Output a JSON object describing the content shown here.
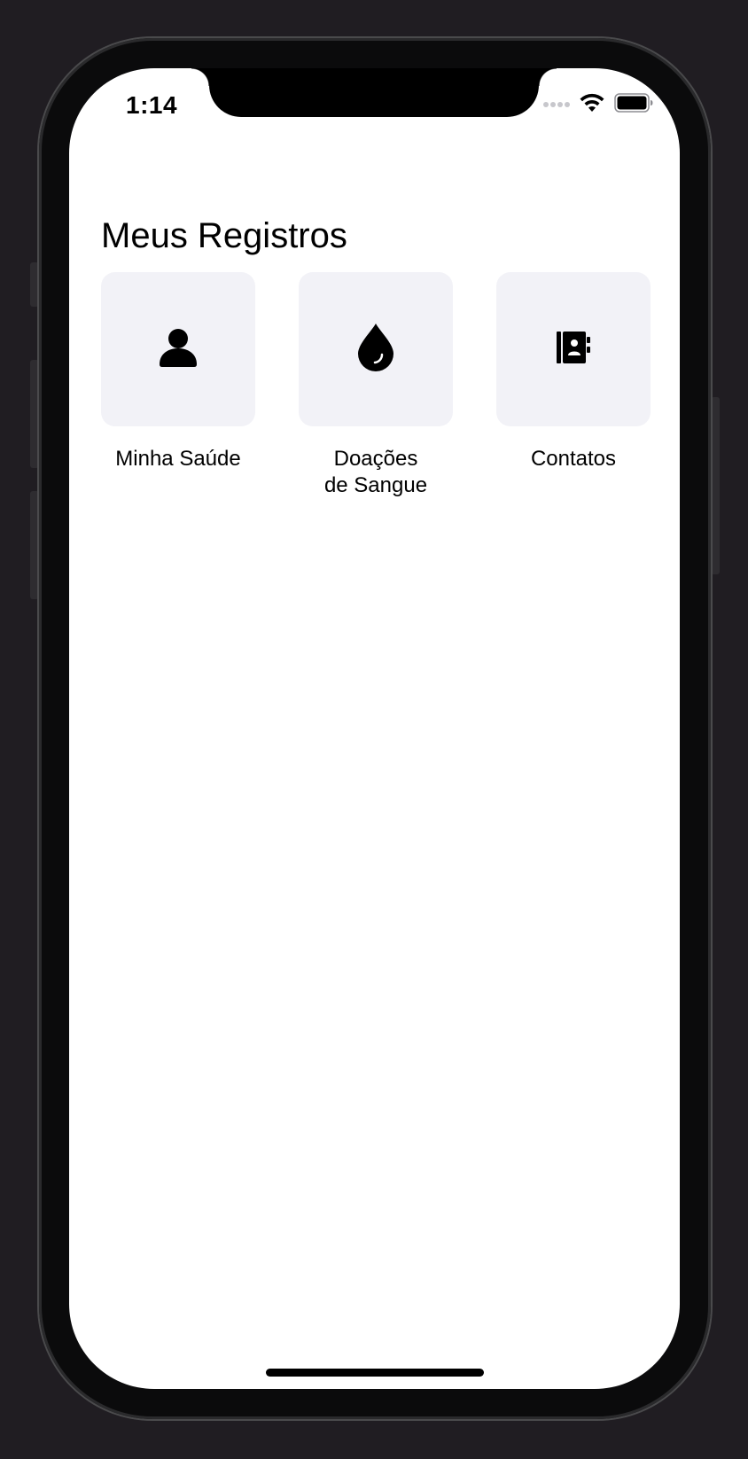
{
  "status_bar": {
    "time": "1:14",
    "signal_icon": "cellular-dots-icon",
    "wifi_icon": "wifi-icon",
    "battery_icon": "battery-full-icon"
  },
  "page": {
    "title": "Meus Registros"
  },
  "tiles": [
    {
      "label": "Minha Saúde",
      "icon": "person-icon"
    },
    {
      "label": "Doações\nde Sangue",
      "icon": "blood-drop-icon"
    },
    {
      "label": "Contatos",
      "icon": "contact-book-icon"
    }
  ],
  "colors": {
    "background": "#ffffff",
    "tile_background": "#f2f2f7",
    "text": "#000000"
  }
}
